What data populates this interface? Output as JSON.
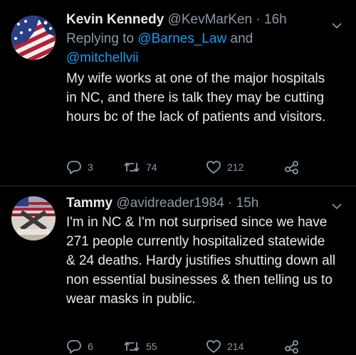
{
  "tweets": [
    {
      "display_name": "Kevin Kennedy",
      "handle": "@KevMarKen",
      "separator": "·",
      "time": "16h",
      "reply_prefix": "Replying to",
      "reply_mention_1": "@Barnes_Law",
      "reply_joiner": "and",
      "reply_mention_2": "@mitchellvii",
      "text": "My wife works at one of the major hospitals in NC, and there is talk they may be cutting hours bc of the lack of patients and visitors.",
      "replies": "3",
      "retweets": "74",
      "likes": "212",
      "avatar_icon": "flag-avatar",
      "menu_icon": "chevron-down-icon"
    },
    {
      "display_name": "Tammy",
      "handle": "@avidreader1984",
      "separator": "·",
      "time": "15h",
      "text": "I'm in NC & I'm not surprised since we have 271 people currently hospitalized statewide & 24 deaths. Hardy justifies shutting down all non essential businesses & then telling us to wear masks in public.",
      "replies": "6",
      "retweets": "55",
      "likes": "214",
      "avatar_icon": "flag-avatar",
      "menu_icon": "chevron-down-icon"
    }
  ],
  "colors": {
    "background": "#000000",
    "text": "#e7e9ea",
    "secondary": "#8b98a5",
    "link": "#1d9bf0",
    "divider": "#2a2d30"
  }
}
